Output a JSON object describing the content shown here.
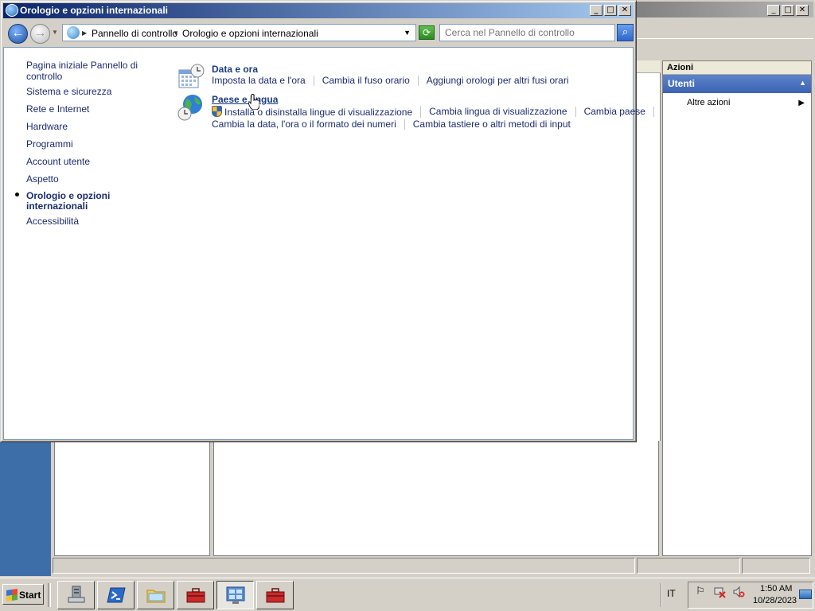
{
  "window": {
    "title": "Orologio e opzioni internazionali",
    "caption_buttons": [
      "_",
      "□",
      "✕"
    ]
  },
  "address_bar": {
    "crumbs": [
      "Pannello di controllo",
      "Orologio e opzioni internazionali"
    ],
    "search_placeholder": "Cerca nel Pannello di controllo"
  },
  "left_nav": {
    "home": "Pagina iniziale Pannello di controllo",
    "items": [
      "Sistema e sicurezza",
      "Rete e Internet",
      "Hardware",
      "Programmi",
      "Account utente",
      "Aspetto",
      "Orologio e opzioni internazionali",
      "Accessibilità"
    ],
    "active_index": 6
  },
  "categories": [
    {
      "title": "Data e ora",
      "icon": "calendar-clock-icon",
      "rows": [
        [
          "Imposta la data e l'ora",
          "Cambia il fuso orario",
          "Aggiungi orologi per altri fusi orari"
        ]
      ]
    },
    {
      "title": "Paese e lingua",
      "icon": "globe-clock-icon",
      "rows": [
        [
          "Installa o disinstalla lingue di visualizzazione",
          "Cambia lingua di visualizzazione",
          "Cambia paese"
        ],
        [
          "Cambia la data, l'ora o il formato dei numeri",
          "Cambia tastiere o altri metodi di input"
        ]
      ]
    }
  ],
  "background_window": {
    "actions_header": "Azioni",
    "section": "Utenti",
    "item": "Altre azioni"
  },
  "taskbar": {
    "start_label": "Start",
    "buttons": [
      "server-manager-icon",
      "powershell-icon",
      "explorer-icon",
      "toolbox-icon",
      "control-panel-icon",
      "toolbox-icon"
    ],
    "pressed_index": 4,
    "language": "IT",
    "time": "1:50 AM",
    "date": "10/28/2023"
  },
  "colors": {
    "title_gradient_start": "#0a246a",
    "link_color": "#1c2b6e",
    "heading_color": "#1a3b83",
    "actions_section": "#3c63b3",
    "desktop": "#3a6ea5"
  }
}
